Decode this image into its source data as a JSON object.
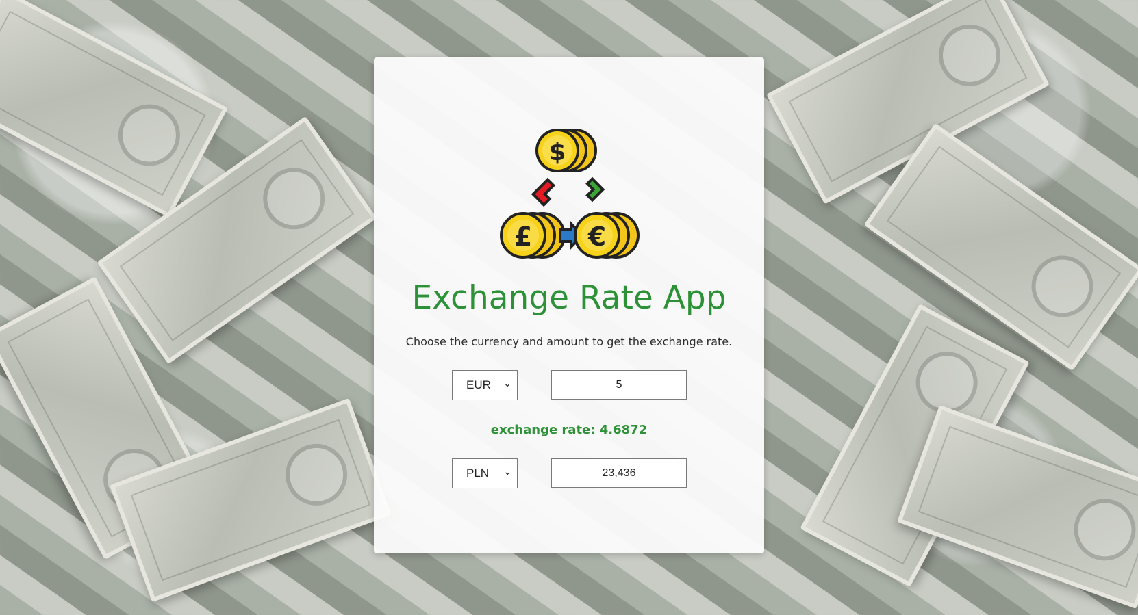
{
  "app": {
    "title": "Exchange Rate App",
    "subtitle": "Choose the currency and amount to get the exchange rate."
  },
  "converter": {
    "from": {
      "currency": "EUR",
      "amount": "5"
    },
    "rate_label": "exchange rate: 4.6872",
    "to": {
      "currency": "PLN",
      "amount": "23,436"
    }
  },
  "logo": {
    "icon": "currency-exchange-icon"
  },
  "colors": {
    "accent": "#2d9237",
    "coin": "#f7d21a",
    "arrow_red": "#e31c23",
    "arrow_green": "#3aa536",
    "arrow_blue": "#2c79c7"
  }
}
